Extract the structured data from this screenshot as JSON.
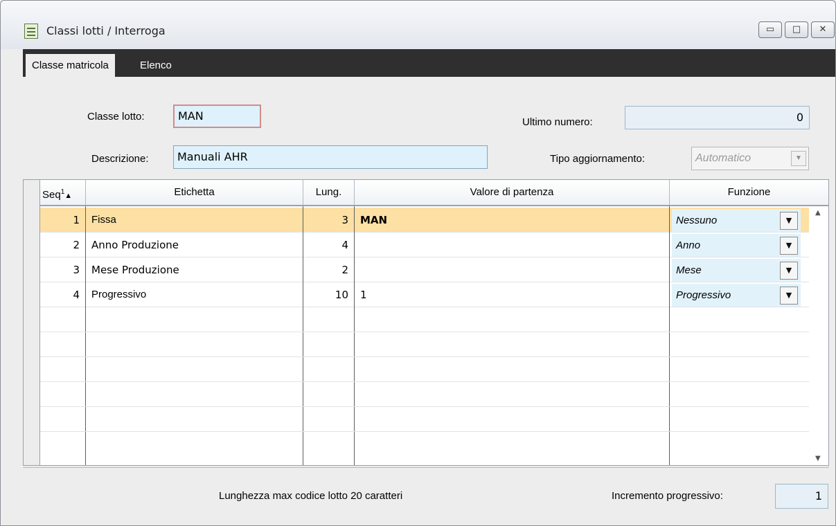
{
  "window": {
    "title": "Classi lotti / Interroga",
    "controls": {
      "minimize": "▭",
      "restore": "□",
      "close": "✕"
    }
  },
  "tabs": [
    {
      "label": "Classe matricola",
      "active": true
    },
    {
      "label": "Elenco",
      "active": false
    }
  ],
  "form": {
    "classe_lotto": {
      "label": "Classe lotto:",
      "value": "MAN"
    },
    "descrizione": {
      "label": "Descrizione:",
      "value": "Manuali AHR"
    },
    "ultimo_numero": {
      "label": "Ultimo numero:",
      "value": "0"
    },
    "tipo_aggiornamento": {
      "label": "Tipo aggiornamento:",
      "value": "Automatico"
    }
  },
  "grid": {
    "columns": {
      "seq": "Seq",
      "seq_sort_mark": "1",
      "etichetta": "Etichetta",
      "lung": "Lung.",
      "valore": "Valore di partenza",
      "funzione": "Funzione"
    },
    "rows": [
      {
        "seq": "1",
        "etichetta": "Fissa",
        "lung": "3",
        "valore": "MAN",
        "funzione": "Nessuno"
      },
      {
        "seq": "2",
        "etichetta": "Anno Produzione",
        "lung": "4",
        "valore": "",
        "funzione": "Anno"
      },
      {
        "seq": "3",
        "etichetta": "Mese Produzione",
        "lung": "2",
        "valore": "",
        "funzione": "Mese"
      },
      {
        "seq": "4",
        "etichetta": "Progressivo",
        "lung": "10",
        "valore": "1",
        "funzione": "Progressivo"
      }
    ]
  },
  "footer": {
    "info": "Lunghezza max codice lotto 20 caratteri",
    "incremento_label": "Incremento progressivo:",
    "incremento_value": "1"
  },
  "colors": {
    "tabbar": "#2f2f2f",
    "selected_row": "#fde0a3",
    "field_bg": "#dff1fb"
  }
}
